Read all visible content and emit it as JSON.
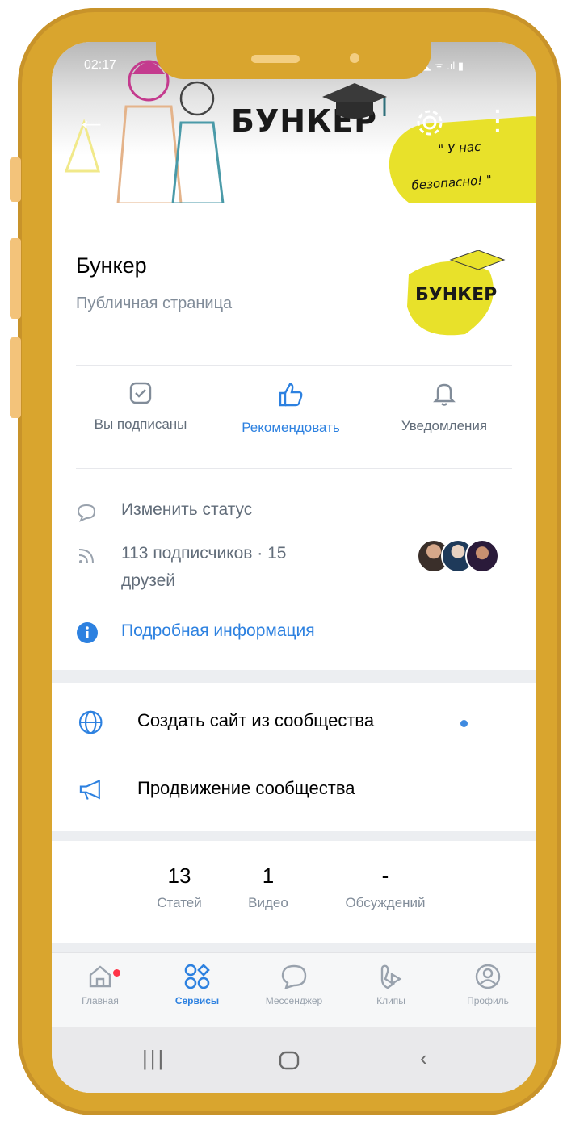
{
  "status_bar": {
    "time": "02:17",
    "icons": "◣ ᯤ .ıl ▮"
  },
  "cover": {
    "title": "БУНКЕР",
    "slogan_line1": "\" У нас",
    "slogan_line2": "безопасно! \""
  },
  "profile": {
    "name": "Бункер",
    "page_type": "Публичная страница",
    "logo_text": "БУНКЕР"
  },
  "actions": [
    {
      "label": "Вы подписаны"
    },
    {
      "label": "Рекомендовать"
    },
    {
      "label": "Уведомления"
    }
  ],
  "info": {
    "status": "Изменить статус",
    "followers_line1": "113 подписчиков · 15",
    "followers_line2": "друзей",
    "details": "Подробная информация"
  },
  "menu": {
    "create_site": "Создать сайт из сообщества",
    "promotion": "Продвижение сообщества"
  },
  "stats": [
    {
      "value": "13",
      "label": "Статей"
    },
    {
      "value": "1",
      "label": "Видео"
    },
    {
      "value": "-",
      "label": "Обсуждений"
    }
  ],
  "tabs": [
    {
      "label": "Главная"
    },
    {
      "label": "Сервисы"
    },
    {
      "label": "Мессенджер"
    },
    {
      "label": "Клипы"
    },
    {
      "label": "Профиль"
    }
  ],
  "colors": {
    "frame": "#d9a52e",
    "accent": "#2d81e0",
    "slogan_bg": "#e8e12a",
    "notification": "#ff3347"
  }
}
